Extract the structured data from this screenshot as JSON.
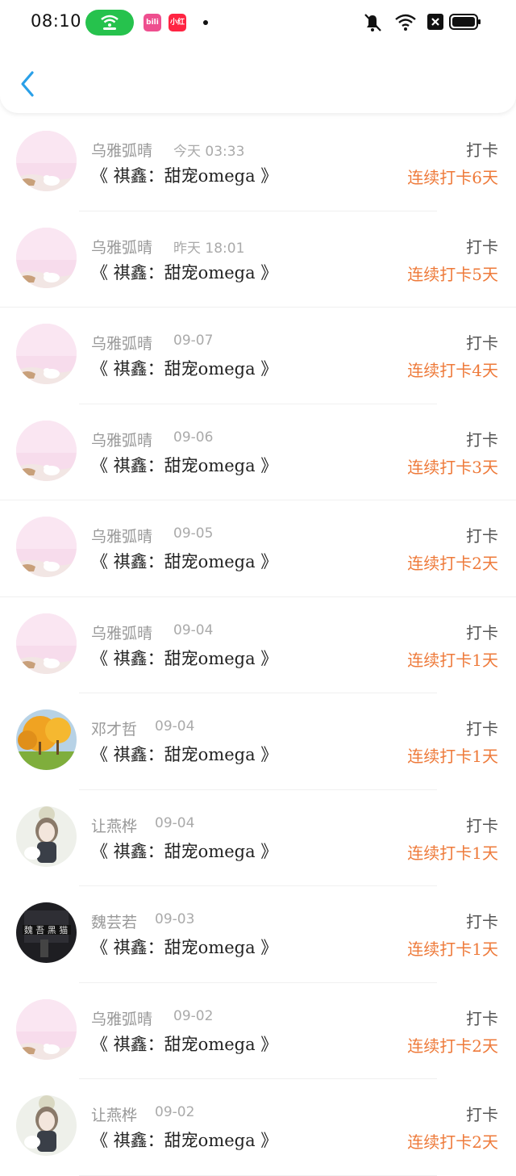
{
  "status_bar": {
    "time": "08:10",
    "badge1": "bili",
    "badge2": "小红书"
  },
  "header": {
    "back_icon": "chevron-left-icon"
  },
  "colors": {
    "accent": "#2aa0e8",
    "streak": "#ee7a3a",
    "wifi_pill": "#26c24d"
  },
  "items": [
    {
      "name": "乌雅弧晴",
      "date": "今天 03:33",
      "title": "《 祺鑫：甜宠omega 》",
      "action": "打卡",
      "streak": "连续打卡6天",
      "avatar": "pink"
    },
    {
      "name": "乌雅弧晴",
      "date": "昨天 18:01",
      "title": "《 祺鑫：甜宠omega 》",
      "action": "打卡",
      "streak": "连续打卡5天",
      "avatar": "pink"
    },
    {
      "name": "乌雅弧晴",
      "date": "09-07",
      "title": "《 祺鑫：甜宠omega 》",
      "action": "打卡",
      "streak": "连续打卡4天",
      "avatar": "pink"
    },
    {
      "name": "乌雅弧晴",
      "date": "09-06",
      "title": "《 祺鑫：甜宠omega 》",
      "action": "打卡",
      "streak": "连续打卡3天",
      "avatar": "pink"
    },
    {
      "name": "乌雅弧晴",
      "date": "09-05",
      "title": "《 祺鑫：甜宠omega 》",
      "action": "打卡",
      "streak": "连续打卡2天",
      "avatar": "pink"
    },
    {
      "name": "乌雅弧晴",
      "date": "09-04",
      "title": "《 祺鑫：甜宠omega 》",
      "action": "打卡",
      "streak": "连续打卡1天",
      "avatar": "pink"
    },
    {
      "name": "邓才哲",
      "date": "09-04",
      "title": "《 祺鑫：甜宠omega 》",
      "action": "打卡",
      "streak": "连续打卡1天",
      "avatar": "autumn"
    },
    {
      "name": "让燕桦",
      "date": "09-04",
      "title": "《 祺鑫：甜宠omega 》",
      "action": "打卡",
      "streak": "连续打卡1天",
      "avatar": "girl"
    },
    {
      "name": "魏芸若",
      "date": "09-03",
      "title": "《 祺鑫：甜宠omega 》",
      "action": "打卡",
      "streak": "连续打卡1天",
      "avatar": "dark"
    },
    {
      "name": "乌雅弧晴",
      "date": "09-02",
      "title": "《 祺鑫：甜宠omega 》",
      "action": "打卡",
      "streak": "连续打卡2天",
      "avatar": "pink"
    },
    {
      "name": "让燕桦",
      "date": "09-02",
      "title": "《 祺鑫：甜宠omega 》",
      "action": "打卡",
      "streak": "连续打卡2天",
      "avatar": "girl"
    }
  ]
}
